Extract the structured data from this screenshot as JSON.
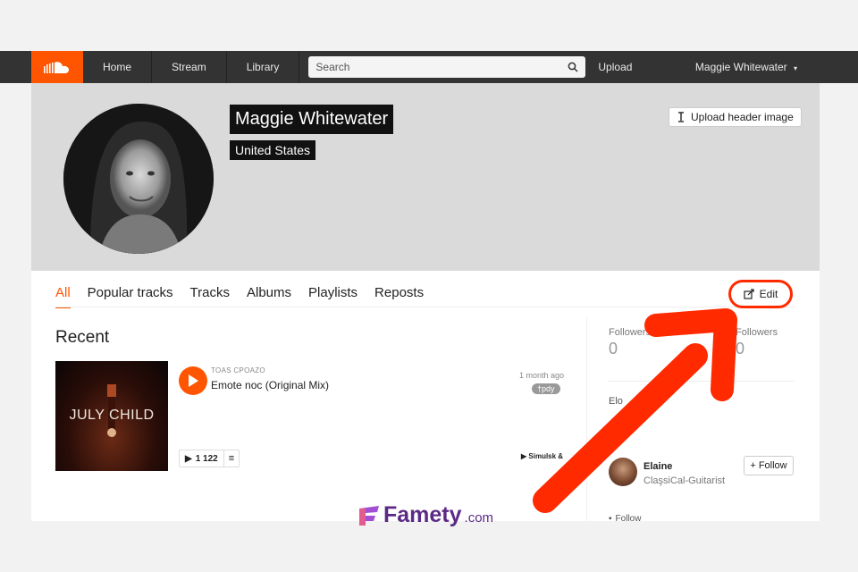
{
  "nav": {
    "logo": "soundcloud-logo",
    "items": [
      {
        "label": "Home"
      },
      {
        "label": "Stream"
      },
      {
        "label": "Library"
      }
    ],
    "search_placeholder": "Search",
    "upload_label": "Upload",
    "user_menu_label": "Maggie Whitewater"
  },
  "profile": {
    "name": "Maggie Whitewater",
    "country": "United States",
    "upload_header_label": "Upload header image"
  },
  "tabs": [
    {
      "label": "All",
      "active": true
    },
    {
      "label": "Popular tracks"
    },
    {
      "label": "Tracks"
    },
    {
      "label": "Albums"
    },
    {
      "label": "Playlists"
    },
    {
      "label": "Reposts"
    }
  ],
  "edit_label": "Edit",
  "recent": {
    "title": "Recent",
    "track": {
      "artwork_text": "JULY CHILD",
      "artist": "TOAS CPOAZO",
      "title": "Emote noc (Original Mix)",
      "date": "1 month ago",
      "tag": "†pdy",
      "plays": "1 122",
      "similar": "Simulsk &"
    }
  },
  "sidebar": {
    "stats": [
      {
        "label": "Followers",
        "value": "0"
      },
      {
        "label": "Followers",
        "value": "0"
      }
    ],
    "heading": "Elo",
    "follower": {
      "name": "Elaine",
      "role": "ClaşsiCal-Guitarist",
      "follow_label": "Follow"
    },
    "follow_link": "Follow"
  },
  "watermark": {
    "brand": "Famety",
    "suffix": ".com"
  },
  "colors": {
    "accent": "#ff5500",
    "annotation": "#ff2a00",
    "watermark": "#5b2a86"
  }
}
